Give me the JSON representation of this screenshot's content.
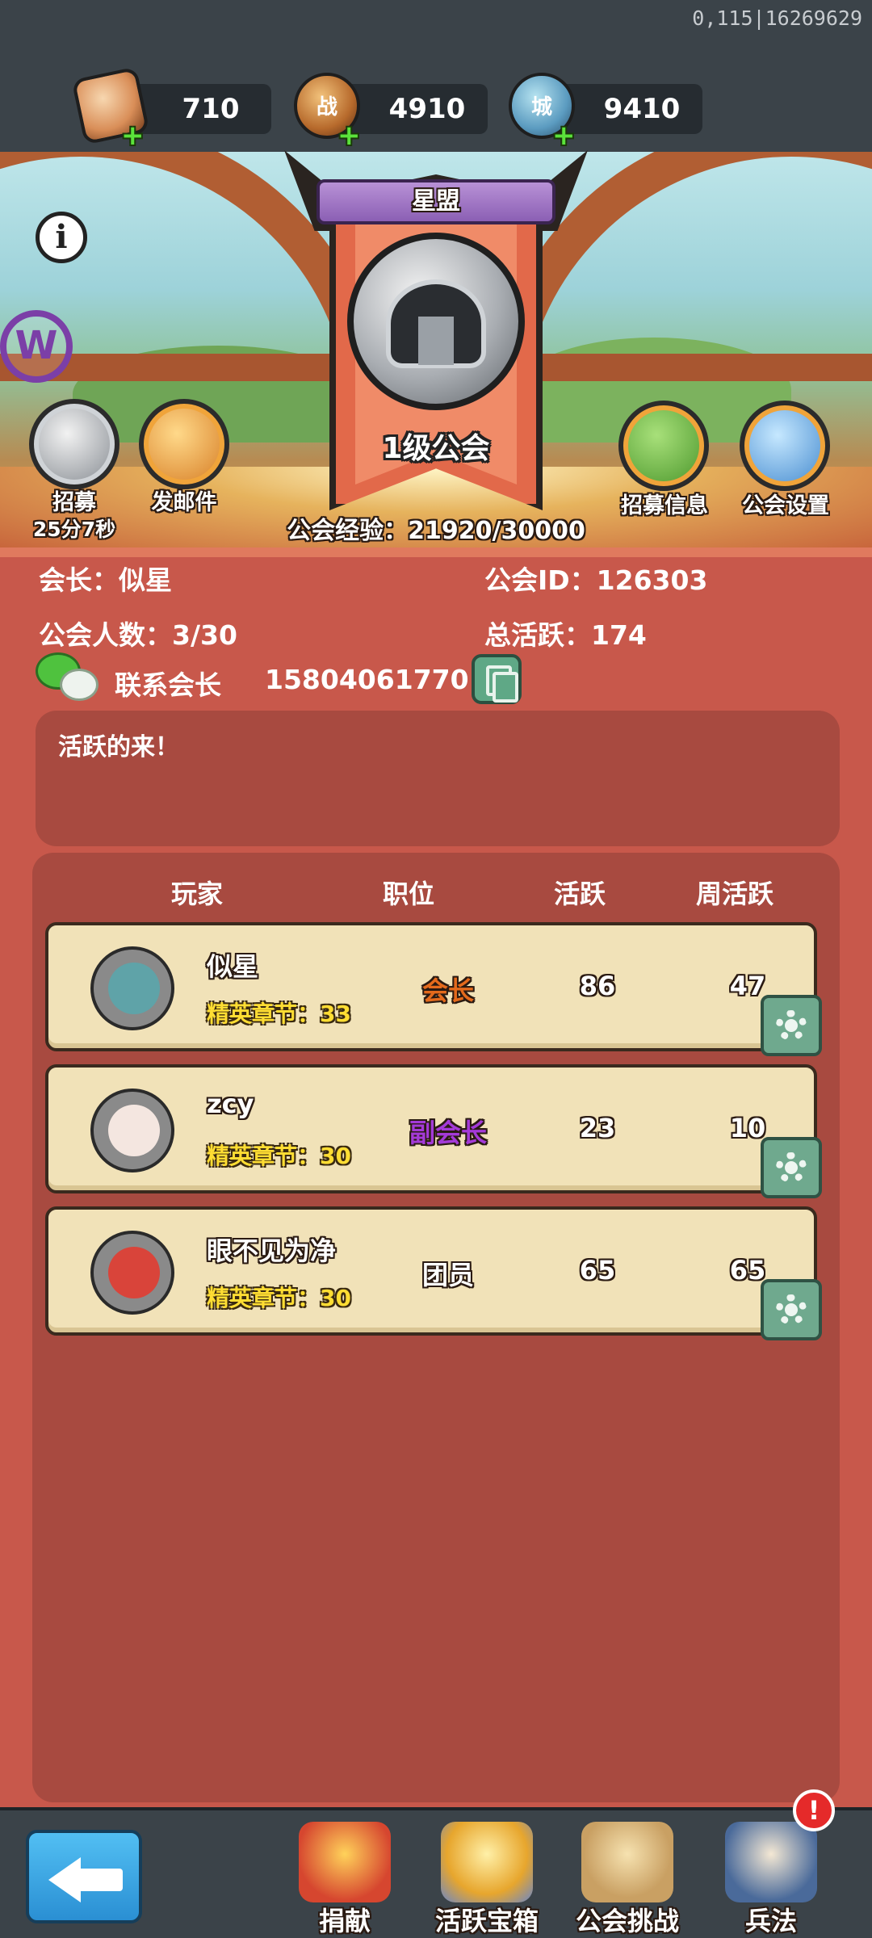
{
  "debug_text": "0,115|16269629",
  "resources": [
    {
      "icon": "recruit-card-icon",
      "value": "710",
      "plus": "+"
    },
    {
      "icon": "battle-token-icon",
      "glyph": "战",
      "value": "4910",
      "plus": "+"
    },
    {
      "icon": "city-token-icon",
      "glyph": "城",
      "value": "9410",
      "plus": "+"
    }
  ],
  "scene": {
    "info_glyph": "i",
    "w_logo": "W",
    "recruit_label": "招募",
    "recruit_timer": "25分7秒",
    "mail_label": "发邮件",
    "recruit_info_label": "招募信息",
    "guild_settings_label": "公会设置"
  },
  "guild": {
    "name": "星盟",
    "level": "1级公会",
    "exp": "公会经验：21920/30000",
    "leader": "会长：似星",
    "guild_id": "公会ID：126303",
    "members_count": "公会人数：3/30",
    "total_activity": "总活跃：174",
    "contact_label": "联系会长",
    "contact_number": "15804061770",
    "notice": "活跃的来！"
  },
  "table": {
    "headers": [
      "玩家",
      "职位",
      "活跃",
      "周活跃"
    ],
    "rows": [
      {
        "name": "似星",
        "label": "精英章节：33",
        "role": "会长",
        "role_color": "#e46a1c",
        "activity": "86",
        "weekly": "47"
      },
      {
        "name": "zcy",
        "label": "精英章节：30",
        "role": "副会长",
        "role_color": "#a43ad8",
        "activity": "23",
        "weekly": "10"
      },
      {
        "name": "眼不见为净",
        "label": "精英章节：30",
        "role": "团员",
        "role_color": "#ffffff",
        "activity": "65",
        "weekly": "65"
      }
    ]
  },
  "bottom_nav": [
    {
      "label": "捐献",
      "icon": "donate-icon"
    },
    {
      "label": "活跃宝箱",
      "icon": "activity-chest-icon"
    },
    {
      "label": "公会挑战",
      "icon": "guild-challenge-icon"
    },
    {
      "label": "兵法",
      "icon": "art-of-war-book-icon"
    }
  ],
  "badge": "!"
}
